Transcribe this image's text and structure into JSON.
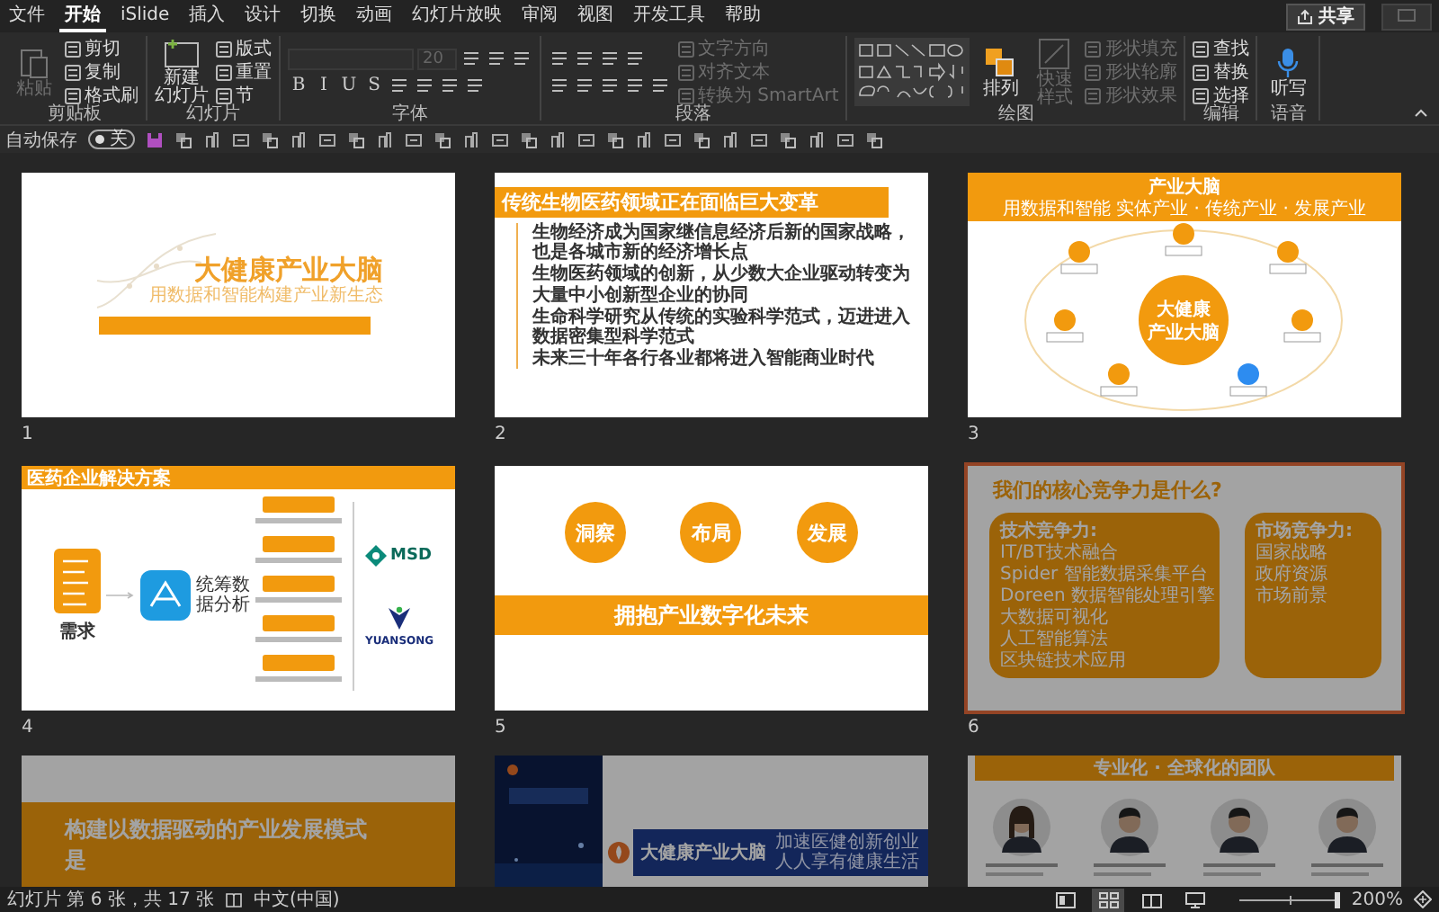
{
  "tabs": [
    {
      "label": "文件",
      "selected": false
    },
    {
      "label": "开始",
      "selected": true
    },
    {
      "label": "iSlide",
      "selected": false
    },
    {
      "label": "插入",
      "selected": false
    },
    {
      "label": "设计",
      "selected": false
    },
    {
      "label": "切换",
      "selected": false
    },
    {
      "label": "动画",
      "selected": false
    },
    {
      "label": "幻灯片放映",
      "selected": false
    },
    {
      "label": "审阅",
      "selected": false
    },
    {
      "label": "视图",
      "selected": false
    },
    {
      "label": "开发工具",
      "selected": false
    },
    {
      "label": "帮助",
      "selected": false
    }
  ],
  "share_button": "共享",
  "ribbon_groups": [
    {
      "label": "剪贴板",
      "columns": [
        [
          [
            {
              "kind": "large",
              "label": "粘贴",
              "disabled": true
            }
          ]
        ],
        [
          [
            {
              "kind": "small",
              "label": "剪切",
              "disabled": false
            }
          ],
          [
            {
              "kind": "small",
              "label": "复制",
              "disabled": false
            }
          ],
          [
            {
              "kind": "small",
              "label": "格式刷",
              "disabled": false
            }
          ]
        ]
      ]
    },
    {
      "label": "幻灯片",
      "columns": [
        [
          [
            {
              "kind": "large",
              "label": "新建幻灯片",
              "disabled": false
            }
          ]
        ],
        [
          [
            {
              "kind": "small",
              "label": "版式",
              "disabled": false
            }
          ],
          [
            {
              "kind": "small",
              "label": "重置",
              "disabled": false
            }
          ],
          [
            {
              "kind": "small",
              "label": "节",
              "disabled": false
            }
          ]
        ]
      ]
    },
    {
      "label": "字体",
      "columns": [
        [
          [
            {
              "kind": "field",
              "disabled": true
            },
            {
              "kind": "field",
              "value": "20",
              "disabled": true
            },
            {
              "kind": "icon",
              "disabled": false
            },
            {
              "kind": "icon",
              "disabled": false
            },
            {
              "kind": "icon",
              "disabled": false
            }
          ],
          [
            {
              "kind": "letter",
              "label": "B",
              "disabled": false
            },
            {
              "kind": "letter",
              "label": "I",
              "disabled": false
            },
            {
              "kind": "letter",
              "label": "U",
              "disabled": false
            },
            {
              "kind": "letter",
              "label": "S",
              "disabled": false
            },
            {
              "kind": "icon",
              "disabled": false
            },
            {
              "kind": "icon",
              "disabled": false
            },
            {
              "kind": "icon",
              "disabled": false
            },
            {
              "kind": "icon",
              "disabled": false
            }
          ]
        ]
      ]
    },
    {
      "label": "段落",
      "columns": [
        [
          [
            {
              "kind": "icon",
              "disabled": false
            },
            {
              "kind": "icon",
              "disabled": false
            },
            {
              "kind": "icon",
              "disabled": false
            },
            {
              "kind": "icon",
              "disabled": false
            }
          ],
          [
            {
              "kind": "icon",
              "disabled": false
            },
            {
              "kind": "icon",
              "disabled": false
            },
            {
              "kind": "icon",
              "disabled": false
            },
            {
              "kind": "icon",
              "disabled": false
            },
            {
              "kind": "icon",
              "disabled": false
            }
          ]
        ],
        [
          [
            {
              "kind": "small",
              "label": "文字方向",
              "disabled": true
            }
          ],
          [
            {
              "kind": "small",
              "label": "对齐文本",
              "disabled": true
            }
          ],
          [
            {
              "kind": "small",
              "label": "转换为 SmartArt",
              "disabled": true
            }
          ]
        ]
      ]
    },
    {
      "label": "绘图",
      "columns": [
        [
          [
            {
              "kind": "gallery",
              "disabled": false
            }
          ]
        ],
        [
          [
            {
              "kind": "large",
              "label": "排列",
              "disabled": false
            }
          ]
        ],
        [
          [
            {
              "kind": "large",
              "label": "快速样式",
              "disabled": true
            }
          ]
        ],
        [
          [
            {
              "kind": "small",
              "label": "形状填充",
              "disabled": true
            }
          ],
          [
            {
              "kind": "small",
              "label": "形状轮廓",
              "disabled": true
            }
          ],
          [
            {
              "kind": "small",
              "label": "形状效果",
              "disabled": true
            }
          ]
        ]
      ]
    },
    {
      "label": "编辑",
      "columns": [
        [
          [
            {
              "kind": "small",
              "label": "查找",
              "disabled": false
            }
          ],
          [
            {
              "kind": "small",
              "label": "替换",
              "disabled": false
            }
          ],
          [
            {
              "kind": "small",
              "label": "选择",
              "disabled": false
            }
          ]
        ]
      ]
    },
    {
      "label": "语音",
      "columns": [
        [
          [
            {
              "kind": "large",
              "label": "听写",
              "disabled": false
            }
          ]
        ]
      ]
    }
  ],
  "autosave": {
    "label": "自动保存",
    "toggle": "关",
    "on": false
  },
  "slides": [
    {
      "kind": "title",
      "number": "1",
      "selected": false,
      "dimmed": false,
      "title": "大健康产业大脑",
      "subtitle": "用数据和智能构建产业新生态"
    },
    {
      "kind": "bullets",
      "number": "2",
      "selected": false,
      "dimmed": false,
      "title": "传统生物医药领域正在面临巨大变革",
      "lines": [
        "**生物经济**成为国家继信息经济后新的国家战略，也是各城市新的经济增长点",
        "生物医药领域的创新，从少数大企业驱动转变为**大量中小创新型企业**的协同",
        "生命科学研究从传统的实验科学范式，迈进进入**数据密集型**科学范式",
        "未来三十年各行各业都将进入**智能商业时代**"
      ]
    },
    {
      "kind": "hub",
      "number": "3",
      "selected": false,
      "dimmed": false,
      "header": "产业大脑",
      "subheader": "用数据和智能 实体产业 · 传统产业 · 发展产业",
      "center": [
        "大健康",
        "产业大脑"
      ]
    },
    {
      "kind": "solution",
      "number": "4",
      "selected": false,
      "dimmed": false,
      "title": "医药企业解决方案",
      "source": "需求",
      "app": "统筹数据分析",
      "partners": [
        "MSD",
        "YUANSONG"
      ]
    },
    {
      "kind": "pillars",
      "number": "5",
      "selected": false,
      "dimmed": false,
      "pillars": [
        "洞察",
        "布局",
        "发展"
      ],
      "banner": "拥抱产业数字化未来"
    },
    {
      "kind": "compare",
      "number": "6",
      "selected": true,
      "dimmed": true,
      "title": "我们的核心竞争力是什么?",
      "boxes": [
        {
          "heading": "技术竞争力:",
          "items": [
            "IT/BT技术融合",
            "Spider 智能数据采集平台",
            "Doreen 数据智能处理引擎",
            "大数据可视化",
            "人工智能算法",
            "区块链技术应用"
          ]
        },
        {
          "heading": "市场竞争力:",
          "items": [
            "国家战略",
            "政府资源",
            "市场前景"
          ]
        }
      ]
    },
    {
      "kind": "statement",
      "selected": false,
      "dimmed": true,
      "lines": [
        "构建以数据驱动的产业发展模式",
        "是"
      ]
    },
    {
      "kind": "cover",
      "selected": false,
      "dimmed": true,
      "title": "大健康产业大脑",
      "lines": [
        "加速医健创新创业",
        "人人享有健康生活"
      ]
    },
    {
      "kind": "team",
      "selected": false,
      "dimmed": true,
      "header": "专业化 · 全球化的团队",
      "members": [
        {
          "kind": "woman"
        },
        {
          "kind": "man"
        },
        {
          "kind": "man"
        },
        {
          "kind": "man"
        }
      ]
    }
  ],
  "status": {
    "slide_info": "幻灯片 第 6 张，共 17 张",
    "language": "中文(中国)",
    "zoom": "200%",
    "zoom_level": {
      "level": 0.95
    }
  },
  "views": [
    {
      "selected": false
    },
    {
      "selected": true
    },
    {
      "selected": false
    },
    {
      "selected": false
    }
  ]
}
